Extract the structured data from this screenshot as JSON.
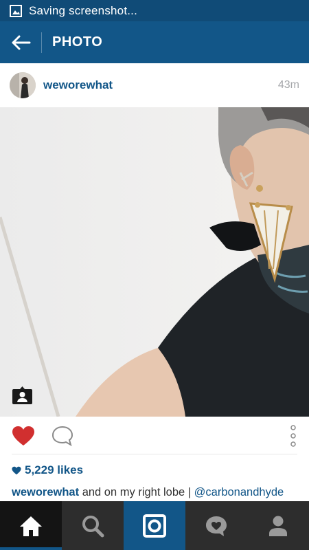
{
  "status_bar": {
    "text": "Saving screenshot...",
    "icon": "image-icon",
    "background": "#104b77"
  },
  "app_bar": {
    "title": "PHOTO",
    "back_icon": "arrow-left-icon",
    "background": "#125688"
  },
  "post": {
    "username": "weworewhat",
    "time_ago": "43m",
    "likes_count": "5,229 likes",
    "liked": true,
    "caption": {
      "username": "weworewhat",
      "text": " and on my right lobe | ",
      "mention": "@carbonandhyde"
    }
  },
  "actions": {
    "like_icon": "heart-icon",
    "comment_icon": "comment-bubble-icon",
    "more_icon": "vertical-dots-icon",
    "tag_icon": "tagged-people-icon"
  },
  "bottom_nav": {
    "items": [
      {
        "name": "home",
        "icon": "home-icon",
        "active": true
      },
      {
        "name": "search",
        "icon": "search-icon"
      },
      {
        "name": "camera",
        "icon": "camera-icon"
      },
      {
        "name": "activity",
        "icon": "activity-heart-icon"
      },
      {
        "name": "profile",
        "icon": "profile-icon"
      }
    ]
  },
  "colors": {
    "brand": "#125688",
    "like_red": "#d12f2f",
    "nav_dark": "#2d2d2d"
  }
}
